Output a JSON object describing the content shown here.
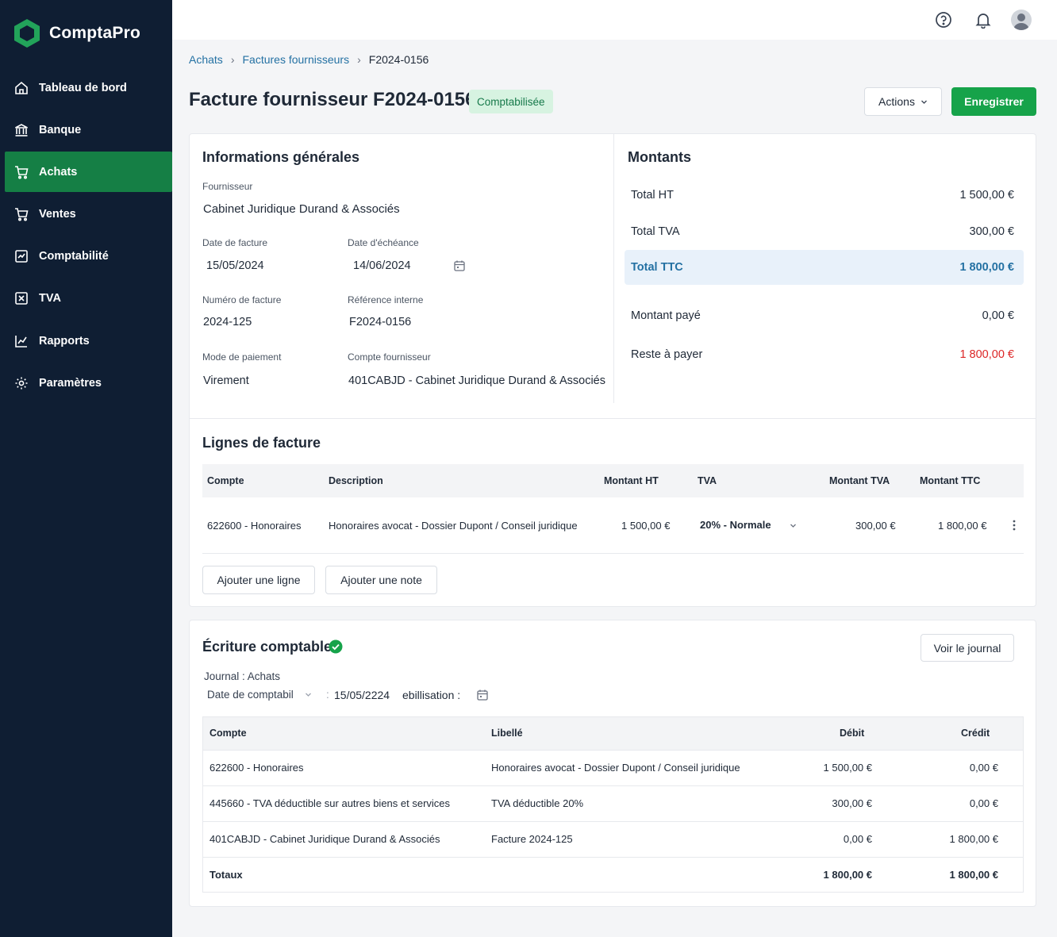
{
  "app": {
    "name": "ComptaPro"
  },
  "sidebar": {
    "items": [
      {
        "label": "Tableau de bord",
        "icon": "home-icon"
      },
      {
        "label": "Banque",
        "icon": "bank-icon"
      },
      {
        "label": "Achats",
        "icon": "cart-icon",
        "active": true
      },
      {
        "label": "Ventes",
        "icon": "cart-icon"
      },
      {
        "label": "Comptabilité",
        "icon": "ledger-icon"
      },
      {
        "label": "TVA",
        "icon": "tax-icon"
      },
      {
        "label": "Rapports",
        "icon": "chart-icon"
      },
      {
        "label": "Paramètres",
        "icon": "gear-icon"
      }
    ]
  },
  "topbar": {
    "icons": [
      "help-icon",
      "bell-icon",
      "user-avatar"
    ]
  },
  "breadcrumb": {
    "items": [
      "Achats",
      "Factures fournisseurs"
    ],
    "current": "F2024-0156"
  },
  "header": {
    "title": "Facture fournisseur F2024-0156",
    "status": "Comptabilisée",
    "actions_label": "Actions",
    "save_label": "Enregistrer"
  },
  "general": {
    "title": "Informations générales",
    "supplier_label": "Fournisseur",
    "supplier_value": "Cabinet Juridique Durand & Associés",
    "invoice_date_label": "Date de facture",
    "invoice_date_value": "15/05/2024",
    "due_date_label": "Date d'échéance",
    "due_date_value": "14/06/2024",
    "invoice_number_label": "Numéro de facture",
    "invoice_number_value": "2024-125",
    "internal_ref_label": "Référence interne",
    "internal_ref_value": "F2024-0156",
    "payment_mode_label": "Mode de paiement",
    "payment_mode_value": "Virement",
    "supplier_account_label": "Compte fournisseur",
    "supplier_account_value": "401CABJD - Cabinet Juridique Durand & Associés"
  },
  "amounts": {
    "title": "Montants",
    "rows": [
      {
        "label": "Total HT",
        "value": "1 500,00 €"
      },
      {
        "label": "Total TVA",
        "value": "300,00 €"
      },
      {
        "label": "Total TTC",
        "value": "1 800,00 €"
      },
      {
        "label": "Montant payé",
        "value": "0,00 €"
      },
      {
        "label": "Reste à payer",
        "value": "1 800,00 €"
      }
    ],
    "colors": {
      "highlight": "#2471a3",
      "due": "#dc2626"
    }
  },
  "lines": {
    "title": "Lignes de facture",
    "headers": [
      "Compte",
      "Description",
      "Montant HT",
      "TVA",
      "Montant TVA",
      "Montant TTC"
    ],
    "rows": [
      {
        "account": "622600 - Honoraires",
        "description": "Honoraires avocat - Dossier Dupont / Conseil juridique",
        "amount_ht": "1 500,00 €",
        "tva": "20% - Normale",
        "amount_tva": "300,00 €",
        "amount_ttc": "1 800,00 €"
      }
    ],
    "add_line_label": "Ajouter une ligne",
    "add_note_label": "Ajouter une note"
  },
  "entry": {
    "title": "Écriture comptable",
    "journal_button": "Voir le journal",
    "journal_text": "Journal : Achats",
    "date_label": "Date de comptabil",
    "date_value": "15/05/2224",
    "date_suffix": "ebillisation :",
    "headers": [
      "Compte",
      "Libellé",
      "Débit",
      "Crédit"
    ],
    "rows": [
      {
        "account": "622600 - Honoraires",
        "label": "Honoraires avocat - Dossier Dupont / Conseil juridique",
        "debit": "1 500,00 €",
        "credit": "0,00 €"
      },
      {
        "account": "445660 - TVA déductible sur autres biens et services",
        "label": "TVA déductible 20%",
        "debit": "300,00 €",
        "credit": "0,00 €"
      },
      {
        "account": "401CABJD - Cabinet Juridique Durand & Associés",
        "label": "Facture 2024-125",
        "debit": "0,00 €",
        "credit": "1 800,00 €"
      }
    ],
    "totals_label": "Totaux",
    "totals_debit": "1 800,00 €",
    "totals_credit": "1 800,00 €"
  }
}
